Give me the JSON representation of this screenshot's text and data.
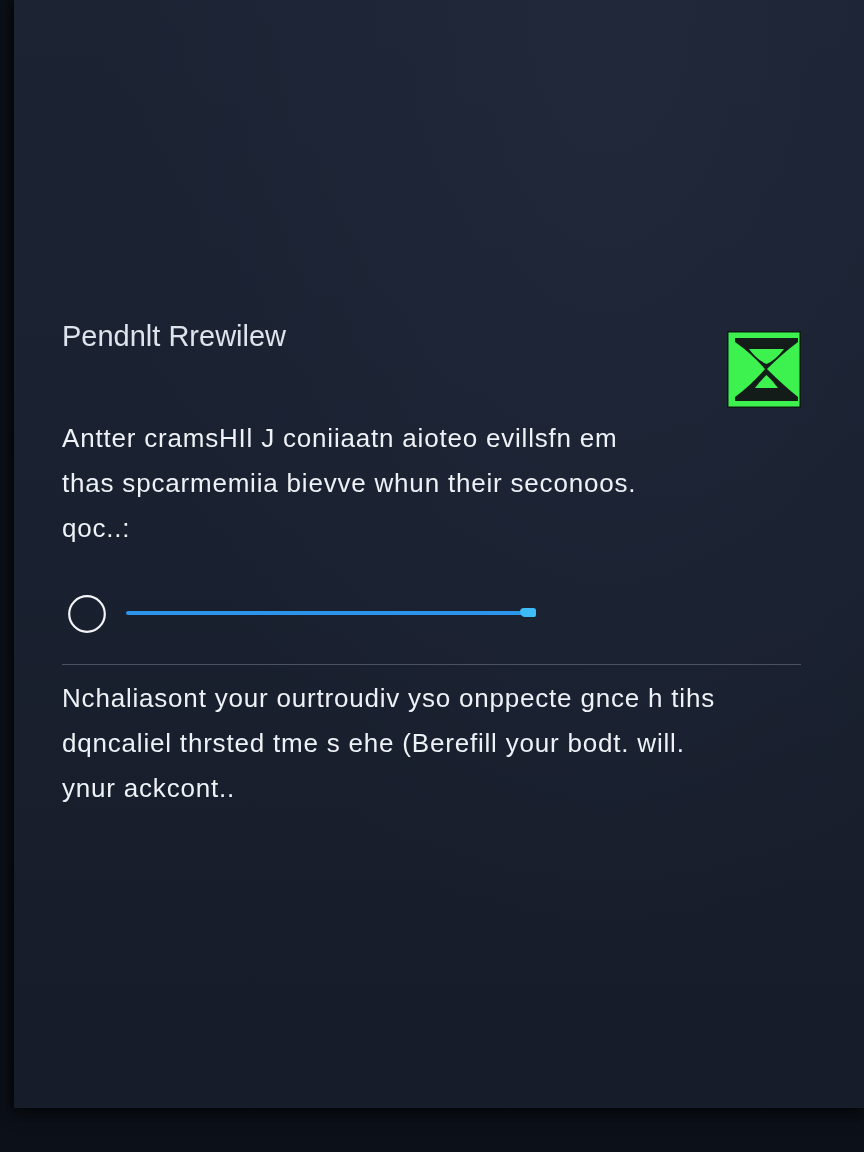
{
  "panel": {
    "title": "Pendnlt Rrewilew",
    "message": "Antter cramsHIl J coniiaatn aioteo evillsfn em\nthas spcarmemiia bievve whun their seconoos.\nqoc..:",
    "progress": {
      "level": 1
    },
    "note": "Nchaliasont your ourtroudiv yso onppecte gnce h tihs\ndqncaliel thrsted tme s ehe (Berefill your bodt. will.\nynur ackcont.."
  }
}
